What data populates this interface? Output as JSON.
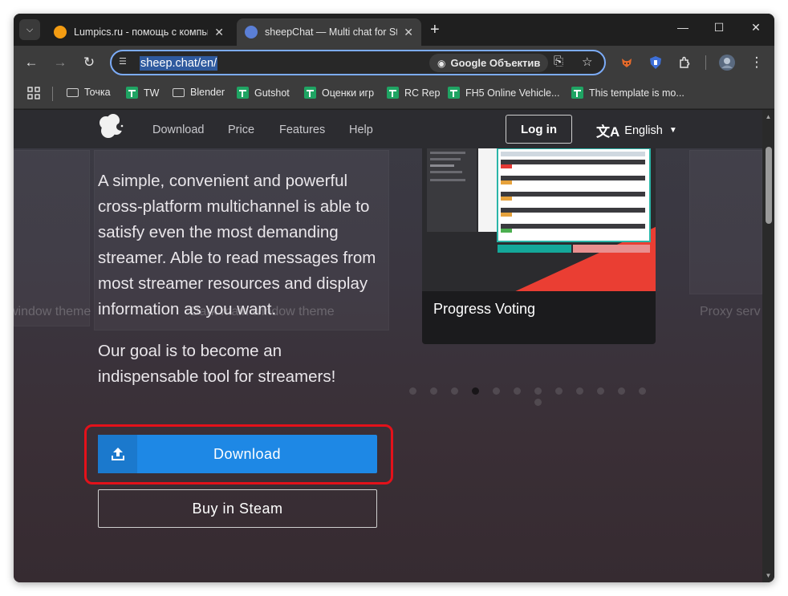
{
  "browser": {
    "tabs": [
      {
        "title": "Lumpics.ru - помощь с компью",
        "favicon_color": "#f39c12",
        "active": false
      },
      {
        "title": "sheepChat — Multi chat for Stre",
        "favicon_color": "#5b7fd6",
        "active": true
      }
    ],
    "tab_close_glyph": "✕",
    "new_tab_glyph": "+",
    "window_controls": {
      "minimize": "—",
      "maximize": "☐",
      "close": "✕"
    },
    "toolbar": {
      "back": "←",
      "forward": "→",
      "reload": "↻",
      "url": "sheep.chat/en/",
      "lens_label": "Google Объектив",
      "translate_glyph": "⎘",
      "star_glyph": "☆",
      "menu_glyph": "⋮"
    },
    "bookmarks": [
      {
        "label": "Точка",
        "icon": "folder-icon"
      },
      {
        "label": "TW",
        "icon": "sheet-icon"
      },
      {
        "label": "Blender",
        "icon": "folder-icon"
      },
      {
        "label": "Gutshot",
        "icon": "sheet-icon"
      },
      {
        "label": "Оценки игр",
        "icon": "sheet-icon"
      },
      {
        "label": "RC Rep",
        "icon": "sheet-icon"
      },
      {
        "label": "FH5 Online Vehicle...",
        "icon": "sheet-icon"
      },
      {
        "label": "This template is mo...",
        "icon": "sheet-icon"
      }
    ]
  },
  "site": {
    "nav": {
      "links": [
        "Download",
        "Price",
        "Features",
        "Help"
      ],
      "login": "Log in",
      "language": "English"
    },
    "background_captions": [
      "window theme",
      "Dark main window theme",
      "Proxy serv"
    ],
    "intro": "A simple, convenient and powerful cross-platform multichannel is able to satisfy even the most demanding streamer. Able to read messages from most streamer resources and display information as you want.",
    "goal": "Our goal is to become an indispensable tool for streamers!",
    "download_button": "Download",
    "steam_button": "Buy in Steam",
    "carousel": {
      "caption": "Progress Voting",
      "dot_count": 13,
      "active_index": 3
    },
    "colors": {
      "accent_blue": "#1e88e5",
      "highlight_red": "#e3111a",
      "slide_red": "#ea3e33"
    }
  }
}
